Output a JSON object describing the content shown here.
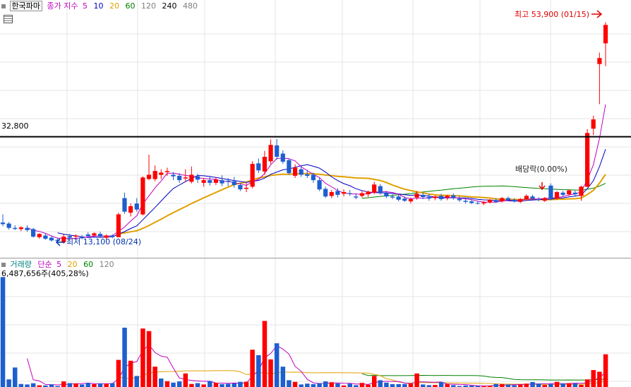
{
  "header": {
    "stock_name": "한국파마",
    "price_label": "종가 지수",
    "ma_periods": [
      "5",
      "10",
      "20",
      "60",
      "120",
      "240",
      "480"
    ],
    "ma_colors": [
      "#c000c0",
      "#0000c0",
      "#e0a000",
      "#008000",
      "#808080",
      "#000000",
      "#808080"
    ]
  },
  "annotations": {
    "high": "최고 53,900 (01/15)",
    "low": "최저 13,100 (08/24)",
    "dividend": "배당락(0.00%)",
    "hline_label": "32,800"
  },
  "volume_header": {
    "title": "거래량",
    "ma_label": "단순",
    "ma_periods": [
      "5",
      "20",
      "60",
      "120"
    ],
    "ma_colors": [
      "#c000c0",
      "#e0a000",
      "#008000",
      "#808080"
    ],
    "current": "6,487,656주(405,28%)"
  },
  "colors": {
    "up": "#ff0000",
    "down": "#1e5fd0",
    "hline": "#000000",
    "grid": "#e4e4e4"
  },
  "chart_data": [
    {
      "type": "candlestick",
      "title": "",
      "price_range": [
        10500,
        58000
      ],
      "hline": 32800,
      "series_note": "OHLC candles, oldest to newest",
      "ohlc": [
        [
          17000,
          18500,
          16300,
          16700
        ],
        [
          16800,
          17100,
          15700,
          16000
        ],
        [
          16000,
          16500,
          15600,
          15800
        ],
        [
          15800,
          16300,
          15400,
          16100
        ],
        [
          16000,
          16500,
          15300,
          15600
        ],
        [
          15800,
          16000,
          14200,
          14400
        ],
        [
          14300,
          15000,
          14000,
          14900
        ],
        [
          14600,
          15000,
          13800,
          14000
        ],
        [
          14200,
          14500,
          13500,
          13700
        ],
        [
          13800,
          14200,
          13400,
          13600
        ],
        [
          13400,
          14800,
          13100,
          14400
        ],
        [
          14500,
          14900,
          13900,
          14200
        ],
        [
          14400,
          14800,
          14000,
          14600
        ],
        [
          14300,
          14700,
          13900,
          14100
        ],
        [
          14800,
          15200,
          14300,
          14500
        ],
        [
          14600,
          15200,
          14400,
          15000
        ],
        [
          14900,
          15300,
          14200,
          14400
        ],
        [
          14200,
          14800,
          13800,
          14600
        ],
        [
          14600,
          14800,
          14100,
          14300
        ],
        [
          14300,
          18800,
          14300,
          18500
        ],
        [
          21500,
          22500,
          18600,
          19000
        ],
        [
          18800,
          20500,
          18100,
          20000
        ],
        [
          20500,
          21500,
          19000,
          19400
        ],
        [
          18500,
          25500,
          18300,
          25300
        ],
        [
          25000,
          29500,
          24800,
          25800
        ],
        [
          25000,
          27500,
          24600,
          26500
        ],
        [
          25800,
          26800,
          25000,
          26200
        ],
        [
          26300,
          27100,
          25600,
          26500
        ],
        [
          25800,
          26300,
          24800,
          25500
        ],
        [
          25600,
          26100,
          24300,
          24800
        ],
        [
          25100,
          26800,
          24500,
          25300
        ],
        [
          24500,
          27300,
          24200,
          25800
        ],
        [
          25500,
          26000,
          24300,
          24900
        ],
        [
          24300,
          25200,
          23600,
          24800
        ],
        [
          24800,
          25600,
          23800,
          24300
        ],
        [
          24300,
          25300,
          23900,
          24900
        ],
        [
          24800,
          25700,
          23700,
          24200
        ],
        [
          24700,
          25200,
          23700,
          24500
        ],
        [
          24600,
          25400,
          23400,
          23900
        ],
        [
          23900,
          24300,
          22800,
          23100
        ],
        [
          23200,
          24300,
          22600,
          23400
        ],
        [
          23600,
          28300,
          23300,
          27800
        ],
        [
          27900,
          28800,
          26100,
          26600
        ],
        [
          26400,
          30200,
          25800,
          29100
        ],
        [
          28300,
          32300,
          27800,
          31300
        ],
        [
          31200,
          32400,
          28600,
          29100
        ],
        [
          29700,
          30300,
          27800,
          28200
        ],
        [
          28500,
          28800,
          25800,
          26100
        ],
        [
          25600,
          27700,
          25200,
          27100
        ],
        [
          26800,
          27400,
          25400,
          25800
        ],
        [
          25900,
          26700,
          25200,
          25600
        ],
        [
          25800,
          26200,
          24300,
          24800
        ],
        [
          24800,
          25300,
          22800,
          23100
        ],
        [
          23200,
          23600,
          21500,
          21800
        ],
        [
          21900,
          23000,
          21500,
          22600
        ],
        [
          22800,
          23300,
          21600,
          22100
        ],
        [
          22300,
          23100,
          21800,
          22600
        ],
        [
          22400,
          23000,
          21900,
          22300
        ],
        [
          21800,
          22400,
          21300,
          21600
        ],
        [
          21900,
          22800,
          21600,
          22400
        ],
        [
          22200,
          22900,
          21700,
          22700
        ],
        [
          22500,
          24500,
          22200,
          24000
        ],
        [
          23700,
          24100,
          22100,
          22500
        ],
        [
          22400,
          22800,
          21500,
          21800
        ],
        [
          21800,
          22200,
          21300,
          21600
        ],
        [
          21800,
          22100,
          20900,
          21200
        ],
        [
          21400,
          21800,
          20800,
          21000
        ],
        [
          20900,
          21600,
          20500,
          21300
        ],
        [
          21600,
          22800,
          21200,
          22300
        ],
        [
          22100,
          22500,
          21300,
          21700
        ],
        [
          21700,
          22300,
          21000,
          21400
        ],
        [
          21500,
          22000,
          21100,
          21800
        ],
        [
          21900,
          22300,
          21000,
          21300
        ],
        [
          21600,
          22100,
          21100,
          21900
        ],
        [
          22000,
          22400,
          21200,
          21600
        ],
        [
          21400,
          21900,
          20800,
          21100
        ],
        [
          21000,
          21400,
          20500,
          20800
        ],
        [
          20900,
          21300,
          20400,
          20600
        ],
        [
          20600,
          21000,
          20300,
          20500
        ],
        [
          20500,
          20900,
          20200,
          20700
        ],
        [
          20700,
          21300,
          20500,
          21200
        ],
        [
          21100,
          21500,
          20600,
          20800
        ],
        [
          20900,
          21700,
          20700,
          21500
        ],
        [
          21500,
          21800,
          20900,
          21100
        ],
        [
          21200,
          21500,
          20700,
          20900
        ],
        [
          20800,
          21500,
          20600,
          21300
        ],
        [
          21300,
          22200,
          21000,
          21900
        ],
        [
          21800,
          22100,
          21200,
          21400
        ],
        [
          21300,
          21700,
          20900,
          21200
        ],
        [
          21000,
          21700,
          20800,
          21500
        ],
        [
          23800,
          24200,
          21100,
          21400
        ],
        [
          21400,
          22800,
          21200,
          22600
        ],
        [
          22500,
          22800,
          21800,
          22100
        ],
        [
          22200,
          23100,
          21900,
          22900
        ],
        [
          22500,
          22900,
          21900,
          22200
        ],
        [
          21900,
          23800,
          21000,
          23600
        ],
        [
          23600,
          34200,
          23500,
          33500
        ],
        [
          34300,
          36700,
          33100,
          36000
        ],
        [
          46200,
          48300,
          38800,
          47300
        ],
        [
          50000,
          53900,
          45800,
          53400
        ]
      ]
    },
    {
      "type": "bar",
      "title": "",
      "ylim": [
        0,
        7000000
      ],
      "values": [
        6487656,
        450000,
        1150000,
        180000,
        150000,
        220000,
        100000,
        90000,
        150000,
        60000,
        330000,
        230000,
        210000,
        150000,
        240000,
        170000,
        210000,
        190000,
        230000,
        1600000,
        3500000,
        1550000,
        650000,
        3450000,
        3300000,
        1200000,
        500000,
        340000,
        260000,
        330000,
        800000,
        180000,
        230000,
        150000,
        350000,
        250000,
        170000,
        190000,
        210000,
        300000,
        310000,
        2200000,
        1880000,
        3900000,
        1630000,
        2580000,
        1200000,
        400000,
        300000,
        150000,
        200000,
        170000,
        220000,
        330000,
        280000,
        210000,
        90000,
        200000,
        110000,
        240000,
        140000,
        650000,
        400000,
        260000,
        170000,
        170000,
        180000,
        200000,
        800000,
        150000,
        110000,
        120000,
        290000,
        180000,
        110000,
        60000,
        90000,
        80000,
        60000,
        50000,
        70000,
        180000,
        170000,
        150000,
        110000,
        140000,
        200000,
        290000,
        200000,
        120000,
        180000,
        300000,
        210000,
        230000,
        210000,
        130000,
        450000,
        1000000,
        900000,
        1930000
      ],
      "up_flags": [
        0,
        0,
        0,
        0,
        0,
        0,
        1,
        0,
        0,
        0,
        1,
        0,
        1,
        0,
        0,
        1,
        0,
        1,
        0,
        1,
        0,
        1,
        0,
        1,
        1,
        1,
        0,
        1,
        0,
        0,
        1,
        1,
        0,
        1,
        0,
        1,
        0,
        0,
        0,
        0,
        1,
        1,
        0,
        1,
        1,
        0,
        0,
        0,
        1,
        0,
        0,
        0,
        0,
        0,
        1,
        0,
        1,
        0,
        0,
        1,
        1,
        1,
        0,
        0,
        0,
        0,
        0,
        1,
        1,
        0,
        0,
        1,
        0,
        1,
        0,
        0,
        0,
        0,
        0,
        1,
        1,
        0,
        1,
        0,
        0,
        1,
        1,
        0,
        0,
        1,
        0,
        1,
        0,
        1,
        0,
        1,
        1,
        1,
        1,
        1
      ]
    }
  ]
}
